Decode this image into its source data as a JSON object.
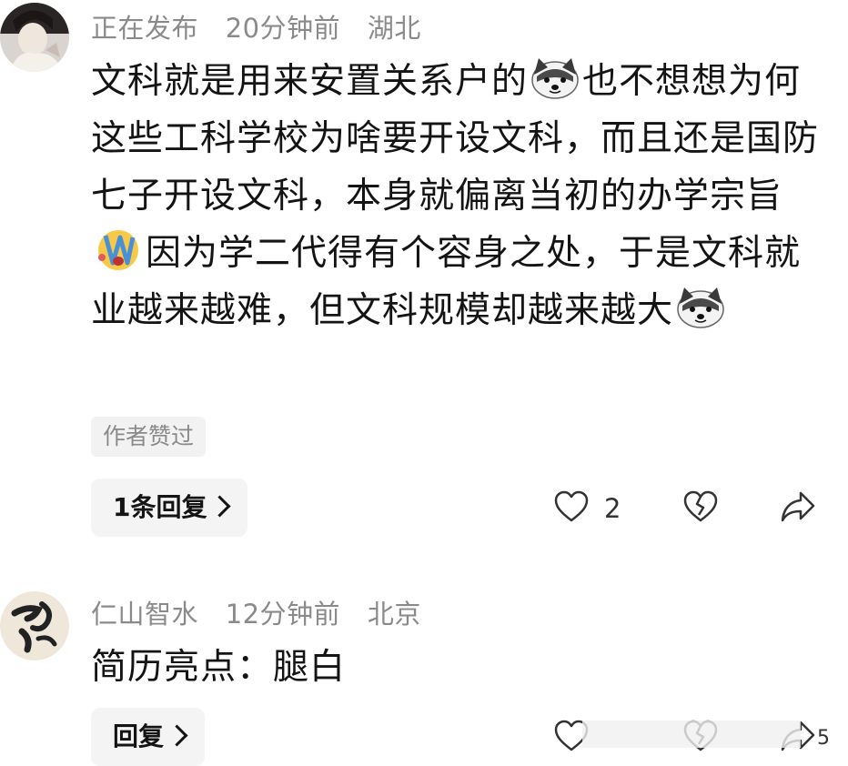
{
  "comments": [
    {
      "username": "正在发布",
      "time": "20分钟前",
      "location": "湖北",
      "text_part1": "文科就是用来安置关系户的",
      "text_part2": "也不想想为何这些工科学校为啥要开设文科，而且还是国防七子开设文科，本身就偏离当初的办学宗旨",
      "text_part3": "因为学二代得有个容身之处，于是文科就业越来越难，但文科规模却越来越大",
      "author_liked": "作者赞过",
      "replies_label": "1条回复",
      "like_count": "2"
    },
    {
      "username": "仁山智水",
      "time": "12分钟前",
      "location": "北京",
      "text": "简历亮点：腿白",
      "replies_label": "回复",
      "like_count": "5"
    }
  ],
  "icons": {
    "emoji_dog": "doge-emoji",
    "emoji_crying": "crying-emoji",
    "like": "heart-outline-icon",
    "dislike": "broken-heart-icon",
    "share": "share-arrow-icon"
  }
}
